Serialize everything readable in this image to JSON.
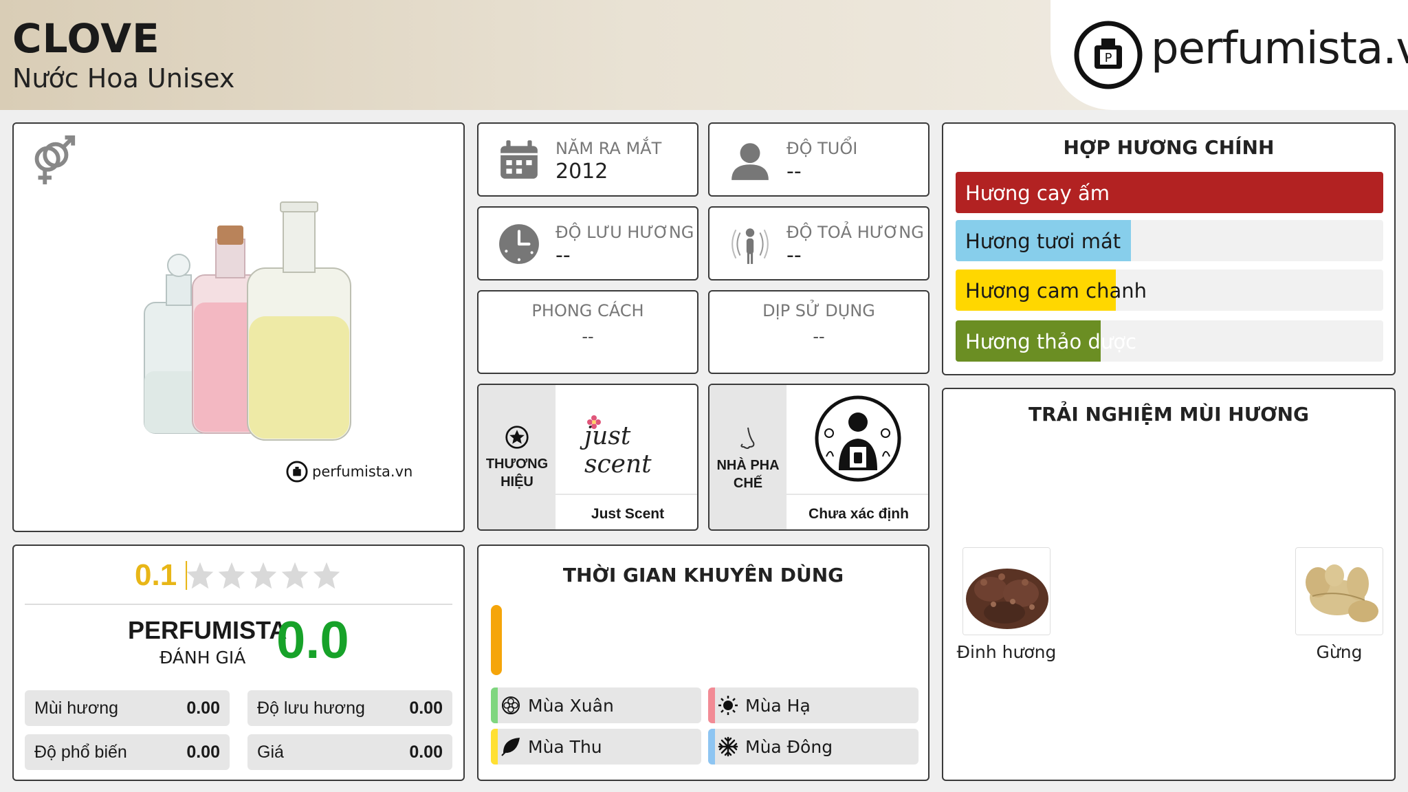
{
  "header": {
    "title": "CLOVE",
    "subtitle": "Nước Hoa Unisex",
    "logo_text": "perfumista.vn"
  },
  "product_image": {
    "gender_icon": "unisex-gender-icon",
    "watermark": "perfumista.vn"
  },
  "info": {
    "year_label": "NĂM RA MẮT",
    "year_value": "2012",
    "age_label": "ĐỘ TUỔI",
    "age_value": "--",
    "longevity_label": "ĐỘ LƯU HƯƠNG",
    "longevity_value": "--",
    "sillage_label": "ĐỘ TOẢ HƯƠNG",
    "sillage_value": "--",
    "style_label": "PHONG CÁCH",
    "style_value": "--",
    "occasion_label": "DỊP SỬ DỤNG",
    "occasion_value": "--"
  },
  "brand": {
    "label_line1": "THƯƠNG",
    "label_line2": "HIỆU",
    "logo_text": "just scent",
    "name": "Just Scent"
  },
  "perfumer": {
    "label_line1": "NHÀ PHA",
    "label_line2": "CHẾ",
    "name": "Chưa xác định"
  },
  "accords": {
    "title": "HỢP HƯƠNG CHÍNH",
    "items": [
      {
        "label": "Hương cay ấm",
        "percent": 100,
        "color": "#b22222",
        "text_color": "#ffffff"
      },
      {
        "label": "Hương tươi mát",
        "percent": 41,
        "color": "#87ceeb",
        "text_color": "#1a1a1a"
      },
      {
        "label": "Hương cam chanh",
        "percent": 37.5,
        "color": "#ffd700",
        "text_color": "#1a1a1a"
      },
      {
        "label": "Hương thảo dược",
        "percent": 34,
        "color": "#6b8e23",
        "text_color": "#ffffff"
      }
    ]
  },
  "rating": {
    "user_score": "0.1",
    "stars_filled_fraction": 0.02,
    "perfumista_label": "PERFUMISTA",
    "perfumista_sub": "ĐÁNH GIÁ",
    "perfumista_score": "0.0",
    "stats": [
      {
        "name": "Mùi hương",
        "value": "0.00"
      },
      {
        "name": "Độ lưu hương",
        "value": "0.00"
      },
      {
        "name": "Độ phổ biến",
        "value": "0.00"
      },
      {
        "name": "Giá",
        "value": "0.00"
      }
    ]
  },
  "time": {
    "title": "THỜI GIAN KHUYÊN DÙNG",
    "bar_color": "#f5a50a",
    "seasons": [
      {
        "name": "Mùa Xuân",
        "color": "#7fd67f",
        "icon": "flower-icon"
      },
      {
        "name": "Mùa Hạ",
        "color": "#f28b95",
        "icon": "sun-icon"
      },
      {
        "name": "Mùa Thu",
        "color": "#ffe033",
        "icon": "leaf-icon"
      },
      {
        "name": "Mùa Đông",
        "color": "#8ec5f2",
        "icon": "snowflake-icon"
      }
    ]
  },
  "experience": {
    "title": "TRẢI NGHIỆM MÙI HƯƠNG",
    "notes": [
      {
        "name": "Đinh hương"
      },
      {
        "name": "Gừng"
      }
    ]
  }
}
